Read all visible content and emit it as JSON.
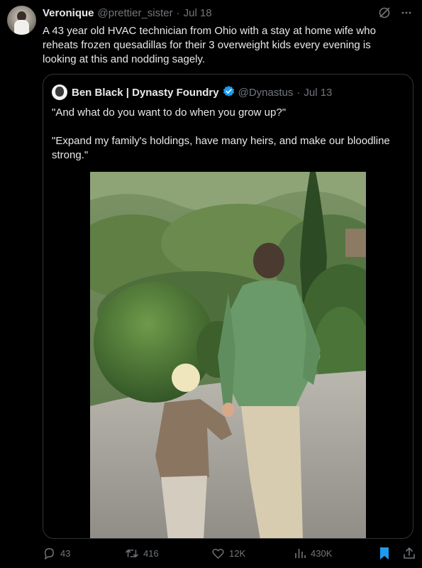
{
  "tweet": {
    "author_name": "Veronique",
    "author_handle": "@prettier_sister",
    "separator": "·",
    "date": "Jul 18",
    "text": "A 43 year old HVAC technician from Ohio with a stay at home wife who reheats frozen quesadillas for their 3 overweight kids every evening is looking at this and nodding sagely."
  },
  "quote": {
    "author_name": "Ben Black | Dynasty Foundry",
    "author_handle": "@Dynastus",
    "separator": "·",
    "date": "Jul 13",
    "paragraph_1": "\"And what do you want to do when you grow up?\"",
    "paragraph_2": "\"Expand my family's holdings, have many heirs, and make our bloodline strong.\""
  },
  "actions": {
    "replies": "43",
    "reposts": "416",
    "likes": "12K",
    "views": "430K"
  },
  "colors": {
    "background": "#000000",
    "text": "#e7e9ea",
    "muted": "#71767b",
    "verified": "#1d9bf0",
    "bookmark": "#1d9bf0",
    "border": "#2f3336"
  },
  "icons": [
    "grok-icon",
    "more-icon",
    "verified-badge-icon",
    "reply-icon",
    "repost-icon",
    "like-icon",
    "views-icon",
    "bookmark-icon",
    "share-icon"
  ]
}
